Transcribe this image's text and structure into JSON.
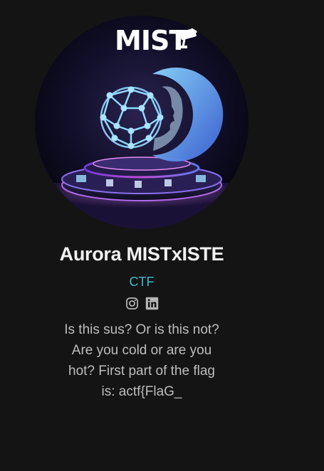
{
  "profile": {
    "logo_text": "MIST",
    "name": "Aurora MISTxISTE",
    "role": "CTF",
    "bio": "Is this sus? Or is this not?\nAre you cold or are you\nhot? First part of the flag\nis: actf{FlaG_"
  },
  "social_links": [
    {
      "icon": "instagram-icon"
    },
    {
      "icon": "linkedin-icon"
    }
  ],
  "colors": {
    "background": "#141414",
    "name": "#f2f2f2",
    "role_accent": "#3db8c9",
    "bio_text": "#bdbdbd",
    "icon_gray": "#b5b5b5"
  }
}
